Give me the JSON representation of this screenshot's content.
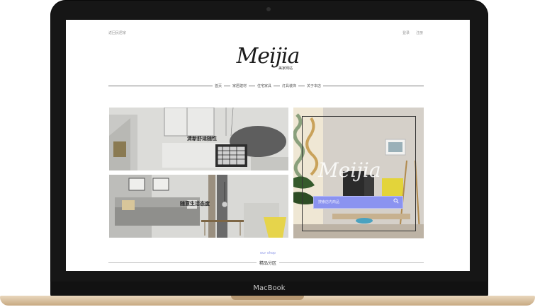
{
  "device": {
    "brand": "MacBook"
  },
  "site": {
    "top_left_link": "返回民居家",
    "login": "登录",
    "register": "注册",
    "logo": "Meijia",
    "logo_sub": "美家网站"
  },
  "nav": {
    "items": [
      "首页",
      "家居建材",
      "住宅家具",
      "灯具装饰",
      "关于本店"
    ]
  },
  "hero": {
    "tile1_text": "清新舒适随性",
    "tile2_text": "随意生活态度",
    "watermark": "Meijia",
    "search_placeholder": "搜索店内商品"
  },
  "section": {
    "eyebrow": "our shop",
    "title": "精品分区"
  },
  "colors": {
    "accent": "#8b93f0",
    "frame": "#161616",
    "base": "#d8c29f"
  }
}
